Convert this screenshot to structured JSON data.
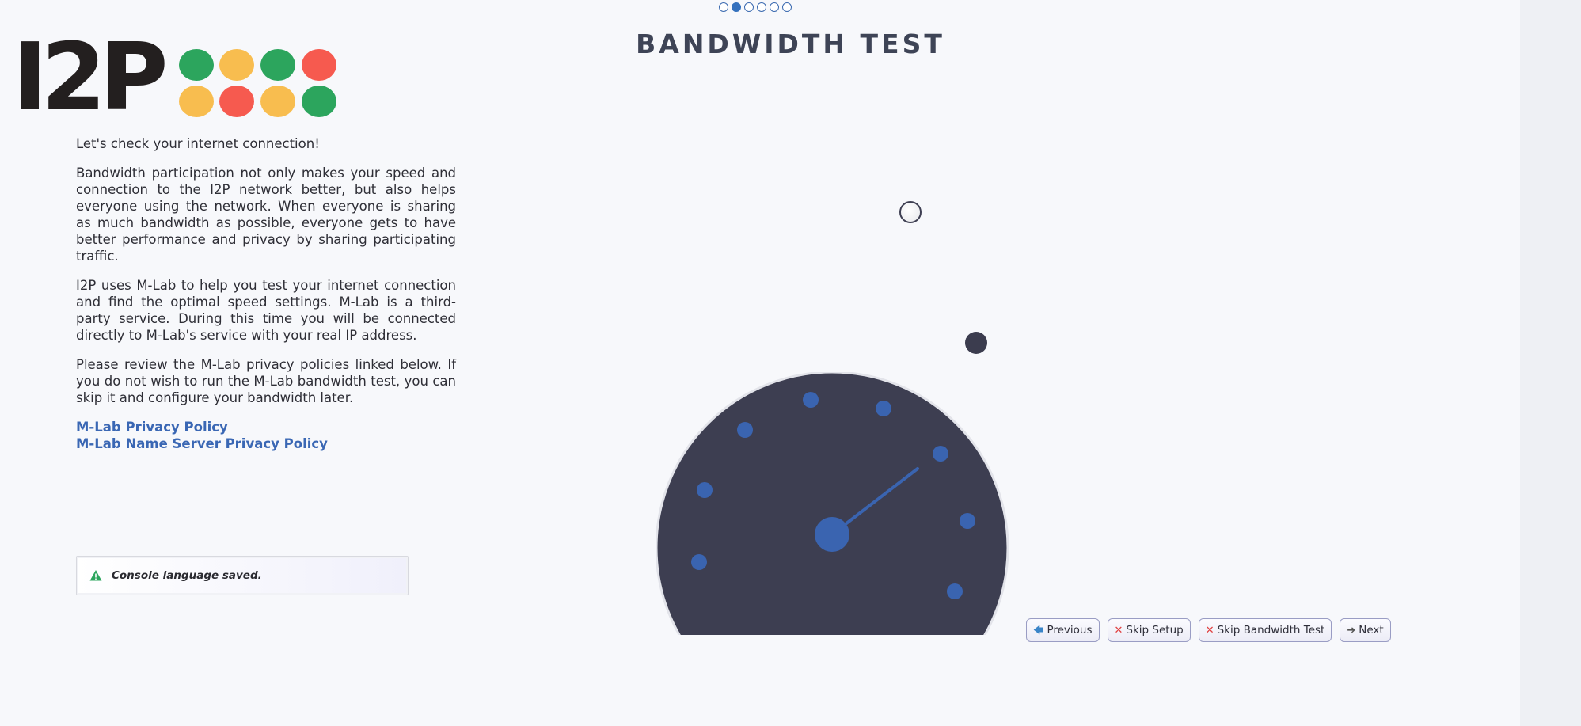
{
  "steps": {
    "total": 6,
    "active_index": 1
  },
  "header": {
    "title": "BANDWIDTH TEST"
  },
  "logo": {
    "text": "I2P",
    "dot_colors": [
      "#2ca55d",
      "#f8bd4f",
      "#2ca55d",
      "#f65a4f",
      "#f8bd4f",
      "#f65a4f",
      "#f8bd4f",
      "#2ca55d"
    ]
  },
  "content": {
    "p1": "Let's check your internet connection!",
    "p2": "Bandwidth participation not only makes your speed and connection to the I2P network better, but also helps everyone using the network. When everyone is sharing as much bandwidth as possible, everyone gets to have better performance and privacy by sharing participating traffic.",
    "p3": "I2P uses M-Lab to help you test your internet connection and find the optimal speed settings. M-Lab is a third-party service. During this time you will be connected directly to M-Lab's service with your real IP address.",
    "p4": "Please review the M-Lab privacy policies linked below. If you do not wish to run the M-Lab bandwidth test, you can skip it and configure your bandwidth later.",
    "link1": "M-Lab Privacy Policy",
    "link2": "M-Lab Name Server Privacy Policy"
  },
  "notice": {
    "text": "Console language saved.",
    "icon": "warning-triangle-icon",
    "color": "#2ca55d"
  },
  "gauge": {
    "face_color": "#3d3e51",
    "tick_color": "#3a64b0",
    "needle_color": "#3a64b0"
  },
  "nav": {
    "previous": "Previous",
    "skip_setup": "Skip Setup",
    "skip_bandwidth": "Skip Bandwidth Test",
    "next": "Next"
  }
}
